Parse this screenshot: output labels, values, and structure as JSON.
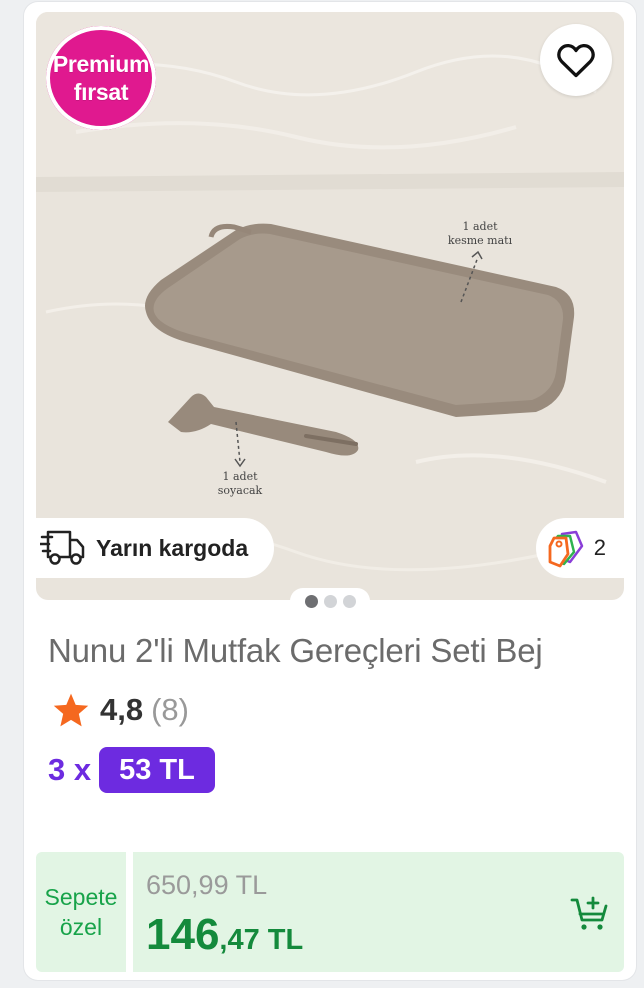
{
  "badge": {
    "line1": "Premium",
    "line2": "fırsat",
    "color": "#e0198f"
  },
  "photo": {
    "annotation_mat_line1": "1 adet",
    "annotation_mat_line2": "kesme matı",
    "annotation_peeler_line1": "1 adet",
    "annotation_peeler_line2": "soyacak"
  },
  "favorite": {
    "icon": "heart-outline-icon"
  },
  "delivery": {
    "icon": "delivery-truck-icon",
    "label": "Yarın kargoda"
  },
  "tags": {
    "icon": "tags-icon",
    "count": "2"
  },
  "carousel": {
    "total": 3,
    "active": 1
  },
  "product": {
    "title": "Nunu 2'li Mutfak Gereçleri Seti Bej"
  },
  "rating": {
    "icon": "star-icon",
    "score": "4,8",
    "count": "(8)",
    "star_color": "#f5681f"
  },
  "installment": {
    "multiplier": "3 x",
    "amount": "53 TL",
    "color": "#6d2be0"
  },
  "price": {
    "label_line1": "Sepete",
    "label_line2": "özel",
    "old": "650,99 TL",
    "new_main": "146",
    "new_rest": ",47 TL",
    "color": "#148a3c"
  },
  "cart": {
    "icon": "add-to-cart-icon"
  }
}
